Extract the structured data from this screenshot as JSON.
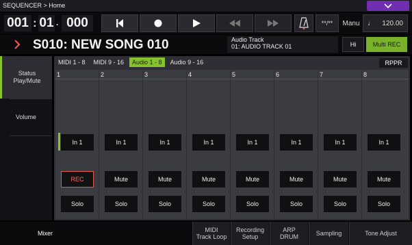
{
  "title_bar": {
    "title": "SEQUENCER > Home"
  },
  "transport": {
    "measure": "001",
    "beat": "01",
    "tick": "000",
    "time_signature": "**/**",
    "tempo_mode": "Manu",
    "tempo": "120.00"
  },
  "song": {
    "name": "S010: NEW SONG 010",
    "track_label": "Audio Track",
    "track_name": "01: AUDIO TRACK 01",
    "hi_label": "Hi",
    "multi_rec_label": "Multi REC"
  },
  "sidebar": {
    "tabs": [
      {
        "label": "Status\nPlay/Mute",
        "active": true
      },
      {
        "label": "Volume",
        "active": false
      }
    ]
  },
  "range_tabs": [
    {
      "label": "MIDI 1 - 8",
      "active": false
    },
    {
      "label": "MIDI 9 - 16",
      "active": false
    },
    {
      "label": "Audio 1 - 8",
      "active": true
    },
    {
      "label": "Audio 9 - 16",
      "active": false
    }
  ],
  "rppr_label": "RPPR",
  "tracks": [
    {
      "number": "1",
      "input": "In 1",
      "rec": "REC",
      "solo": "Solo"
    },
    {
      "number": "2",
      "input": "In 1",
      "mute": "Mute",
      "solo": "Solo"
    },
    {
      "number": "3",
      "input": "In 1",
      "mute": "Mute",
      "solo": "Solo"
    },
    {
      "number": "4",
      "input": "In 1",
      "mute": "Mute",
      "solo": "Solo"
    },
    {
      "number": "5",
      "input": "In 1",
      "mute": "Mute",
      "solo": "Solo"
    },
    {
      "number": "6",
      "input": "In 1",
      "mute": "Mute",
      "solo": "Solo"
    },
    {
      "number": "7",
      "input": "In 1",
      "mute": "Mute",
      "solo": "Solo"
    },
    {
      "number": "8",
      "input": "In 1",
      "mute": "Mute",
      "solo": "Solo"
    }
  ],
  "bottom_tabs": [
    {
      "label": "Mixer",
      "active": true
    },
    {
      "label": "MIDI\nTrack Loop",
      "active": false
    },
    {
      "label": "Recording\nSetup",
      "active": false
    },
    {
      "label": "ARP\nDRUM",
      "active": false
    },
    {
      "label": "Sampling",
      "active": false
    },
    {
      "label": "Tone Adjust",
      "active": false
    }
  ],
  "colors": {
    "accent_green": "#86c22e",
    "menu_purple": "#6f2fb0",
    "rec_red": "#e25a52"
  }
}
